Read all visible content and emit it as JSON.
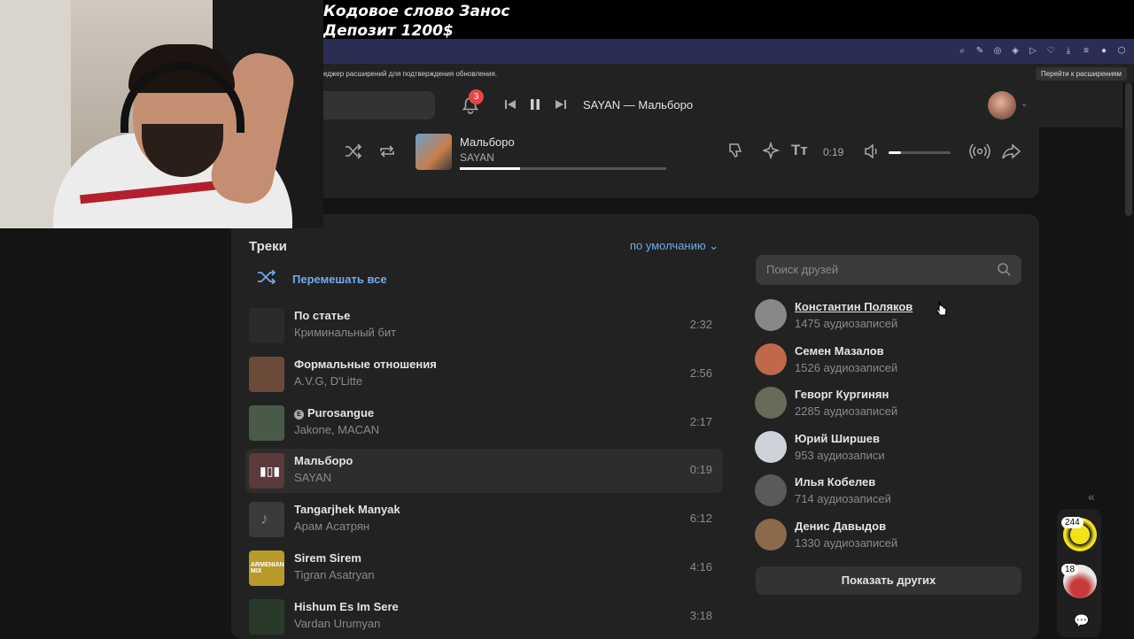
{
  "overlay": {
    "line1": "Кодовое слово Занос",
    "line2": "Депозит 1200$"
  },
  "browser": {
    "notice": "еджер расширений для подтверждения обновления.",
    "notice_button": "Перейти к расширениям"
  },
  "header": {
    "notifications_count": "3",
    "now_playing": "SAYAN — Мальборо"
  },
  "player": {
    "title": "Мальборо",
    "artist": "SAYAN",
    "time": "0:19",
    "progress": 0.29,
    "volume": 0.2
  },
  "tracks": {
    "heading": "Треки",
    "sort_label": "по умолчанию",
    "shuffle_label": "Перемешать все",
    "items": [
      {
        "title": "По статье",
        "artist": "Криминальный бит",
        "duration": "2:32",
        "cover": "#2b2b2b"
      },
      {
        "title": "Формальные отношения",
        "artist": "A.V.G, D'Litte",
        "duration": "2:56",
        "cover": "#6b4a3a"
      },
      {
        "title": "Purosangue",
        "artist": "Jakone, MACAN",
        "duration": "2:17",
        "cover": "#4a5a48",
        "explicit": "E"
      },
      {
        "title": "Мальборо",
        "artist": "SAYAN",
        "duration": "0:19",
        "cover": "#5a3a3a"
      },
      {
        "title": "Tangarjhek Manyak",
        "artist": "Арам Асатрян",
        "duration": "6:12",
        "cover": "#3a3a3a"
      },
      {
        "title": "Sirem Sirem",
        "artist": "Tigran Asatryan",
        "duration": "4:16",
        "cover": "#b89a2a",
        "cover_text": "ARMENIAN MIX"
      },
      {
        "title": "Hishum Es Im Sere",
        "artist": "Vardan Urumyan",
        "duration": "3:18",
        "cover": "#2a3a2a"
      }
    ]
  },
  "friends": {
    "search_placeholder": "Поиск друзей",
    "items": [
      {
        "name": "Константин Поляков",
        "count": "1475 аудиозаписей",
        "color": "#888888"
      },
      {
        "name": "Семен Мазалов",
        "count": "1526 аудиозаписей",
        "color": "#c0684a"
      },
      {
        "name": "Геворг Кургинян",
        "count": "2285 аудиозаписей",
        "color": "#6a6a5a"
      },
      {
        "name": "Юрий Ширшев",
        "count": "953 аудиозаписи",
        "color": "#cfd3d9"
      },
      {
        "name": "Илья Кобелев",
        "count": "714 аудиозаписей",
        "color": "#5a5a5a"
      },
      {
        "name": "Денис Давыдов",
        "count": "1330 аудиозаписей",
        "color": "#8a6a4a"
      }
    ],
    "show_others": "Показать других"
  },
  "rail": {
    "count1": "244",
    "count2": "18"
  }
}
